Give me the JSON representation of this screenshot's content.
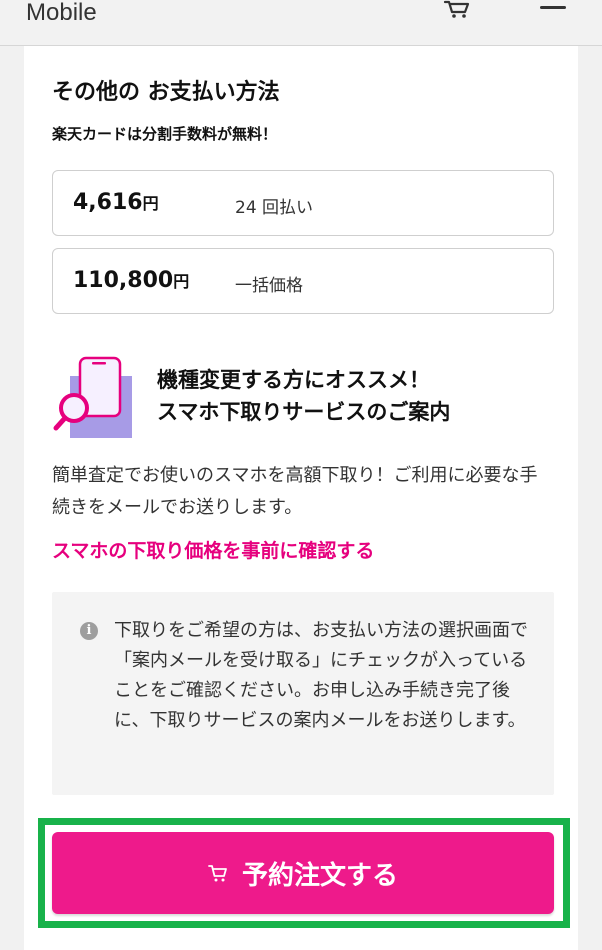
{
  "header": {
    "brand": "Mobile",
    "cart_icon": "cart-icon",
    "menu_icon": "hamburger-menu-icon"
  },
  "payment": {
    "title": "その他の お支払い方法",
    "subtitle": "楽天カードは分割手数料が無料！",
    "options": [
      {
        "amount": "4,616",
        "unit": "円",
        "label": "24 回払い"
      },
      {
        "amount": "110,800",
        "unit": "円",
        "label": "一括価格"
      }
    ]
  },
  "promo": {
    "title_line1": "機種変更する方にオススメ！",
    "title_line2": "スマホ下取りサービスのご案内",
    "description": "簡単査定でお使いのスマホを高額下取り！ご利用に必要な手続きをメールでお送りします。",
    "link_text": "スマホの下取り価格を事前に確認する",
    "illustration": "phone-magnifier-illustration"
  },
  "notice": {
    "icon": "info-icon",
    "icon_glyph": "i",
    "text": "下取りをご希望の方は、お支払い方法の選択画面で「案内メールを受け取る」にチェックが入っていることをご確認ください。お申し込み手続き完了後に、下取りサービスの案内メールをお送りします。"
  },
  "cta": {
    "label": "予約注文する",
    "icon": "cart-icon",
    "highlight_color": "#18b24a",
    "button_color": "#ee1a8b"
  },
  "colors": {
    "accent_pink": "#e6007e",
    "brand_pink": "#ee1a8b",
    "highlight_green": "#18b24a",
    "illustration_purple": "#a79be6"
  }
}
